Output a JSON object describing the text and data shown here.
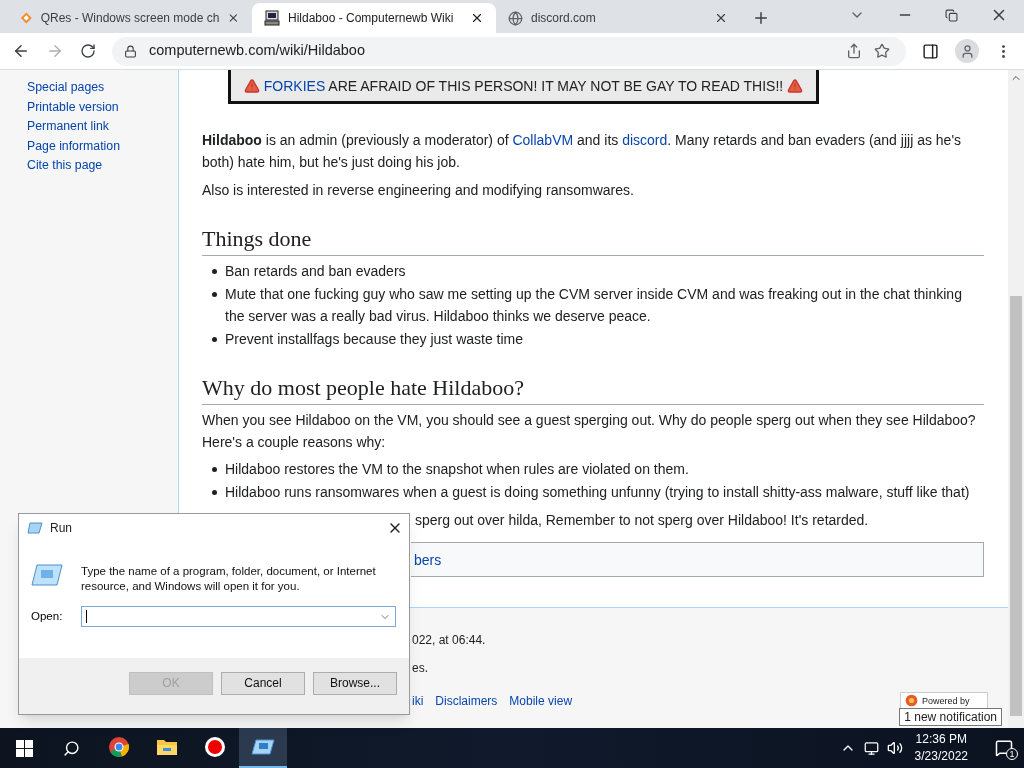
{
  "browser": {
    "tabs": [
      {
        "title": "QRes - Windows screen mode ch",
        "selected": false,
        "kind": "diamond"
      },
      {
        "title": "Hildaboo - Computernewb Wiki",
        "selected": true,
        "kind": "computer"
      },
      {
        "title": "discord.com",
        "selected": false,
        "kind": "globe"
      }
    ],
    "url": "computernewb.com/wiki/Hildaboo"
  },
  "sidebar": {
    "items": [
      "Special pages",
      "Printable version",
      "Permanent link",
      "Page information",
      "Cite this page"
    ]
  },
  "article": {
    "banner": [
      {
        "kind": "link",
        "text": "FORKIES"
      },
      {
        "kind": "plain",
        "text": " ARE AFRAID OF THIS PERSON! IT MAY NOT BE GAY TO READ THIS!!"
      }
    ],
    "intro": [
      [
        {
          "kind": "bold",
          "text": "Hildaboo"
        },
        {
          "kind": "plain",
          "text": " is an admin (previously a moderator) of "
        },
        {
          "kind": "link",
          "text": "CollabVM"
        },
        {
          "kind": "plain",
          "text": " and its "
        },
        {
          "kind": "link",
          "text": "discord"
        },
        {
          "kind": "plain",
          "text": ". Many retards and ban evaders (and jjjj as he's both) hate him, but he's just doing his job."
        }
      ],
      [
        {
          "kind": "plain",
          "text": "Also is interested in reverse engineering and modifying ransomwares."
        }
      ]
    ],
    "sections": [
      {
        "heading": "Things done",
        "bullets": [
          "Ban retards and ban evaders",
          "Mute that one fucking guy who saw me setting up the CVM server inside CVM and was freaking out in the chat thinking the server was a really bad virus. Hildaboo thinks we deserve peace.",
          "Prevent installfags because they just waste time"
        ]
      },
      {
        "heading": "Why do most people hate Hildaboo?",
        "paragraphs": [
          "When you see Hildaboo on the VM, you should see a guest sperging out. Why do people sperg out when they see Hildaboo? Here's a couple reasons why:"
        ],
        "bullets": [
          "Hildaboo restores the VM to the snapshot when rules are violated on them.",
          "Hildaboo runs ransomwares when a guest is doing something unfunny (trying to install shitty-ass malware, stuff like that)"
        ],
        "after": [
          "sperg out over hilda, Remember to not sperg over Hildaboo! It's retarded."
        ]
      }
    ],
    "categories": {
      "items": [
        "bers"
      ]
    }
  },
  "footer": {
    "lines": [
      "022, at 06:44.",
      "es."
    ],
    "links": [
      "iki",
      "Disclaimers",
      "Mobile view"
    ],
    "badge": "Powered by",
    "notification": "1 new notification"
  },
  "run_dialog": {
    "title": "Run",
    "message": "Type the name of a program, folder, document, or Internet resource, and Windows will open it for you.",
    "open_label": "Open:",
    "buttons": [
      {
        "label": "OK",
        "disabled": true
      },
      {
        "label": "Cancel",
        "disabled": false
      },
      {
        "label": "Browse...",
        "disabled": false
      }
    ]
  },
  "taskbar": {
    "apps": [
      {
        "kind": "chrome",
        "active": false
      },
      {
        "kind": "folder",
        "active": false
      },
      {
        "kind": "record",
        "active": false
      },
      {
        "kind": "run",
        "active": true
      }
    ],
    "time": "12:36 PM",
    "date": "3/23/2022",
    "notifications": "1"
  }
}
